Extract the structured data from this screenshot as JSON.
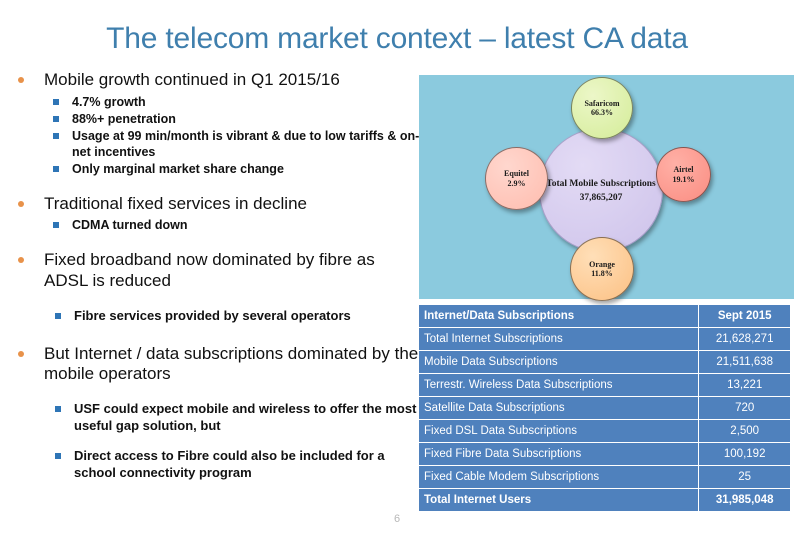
{
  "slide": {
    "title": "The telecom market context – latest CA data",
    "page_number": "6"
  },
  "colors": {
    "title": "#3f7fad",
    "bullet_level1": "#e8924a",
    "bullet_level2": "#2e75b6",
    "table_fill": "#4f81bd",
    "chart_background": "#8bcade"
  },
  "bullets": [
    {
      "text": "Mobile growth continued in Q1 2015/16",
      "sub": [
        "4.7% growth",
        "88%+ penetration",
        "Usage at 99 min/month is vibrant & due to low tariffs & on-net incentives",
        "Only marginal market share change"
      ]
    },
    {
      "text": "Traditional fixed services in decline",
      "sub": [
        "CDMA turned down"
      ]
    },
    {
      "text": "Fixed broadband now dominated by fibre as ADSL is reduced",
      "sub": [
        "Fibre services provided by several operators"
      ]
    },
    {
      "text": "But Internet / data subscriptions dominated by the mobile operators",
      "sub": [
        "USF could expect mobile and wireless to offer the most useful gap solution, but",
        "Direct access to Fibre could also be included for a school connectivity program"
      ]
    }
  ],
  "chart_data": {
    "type": "pie",
    "title": "Total Mobile Subscriptions",
    "center_label": "Total Mobile Subscriptions",
    "center_value": "37,865,207",
    "categories": [
      "Safaricom",
      "Airtel",
      "Orange",
      "Equitel"
    ],
    "values": [
      66.3,
      19.1,
      11.8,
      2.9
    ],
    "labels": [
      "66.3%",
      "19.1%",
      "11.8%",
      "2.9%"
    ],
    "units": "percent market share",
    "legend": "none",
    "grid": false
  },
  "table": {
    "columns": [
      "Internet/Data Subscriptions",
      "Sept 2015"
    ],
    "rows": [
      {
        "label": "Total Internet Subscriptions",
        "value": "21,628,271"
      },
      {
        "label": "Mobile Data Subscriptions",
        "value": "21,511,638"
      },
      {
        "label": "Terrestr. Wireless Data Subscriptions",
        "value": "13,221"
      },
      {
        "label": "Satellite Data Subscriptions",
        "value": "720"
      },
      {
        "label": "Fixed DSL Data Subscriptions",
        "value": "2,500"
      },
      {
        "label": "Fixed Fibre Data Subscriptions",
        "value": "100,192"
      },
      {
        "label": "Fixed Cable Modem Subscriptions",
        "value": "25"
      }
    ],
    "total": {
      "label": "Total Internet Users",
      "value": "31,985,048"
    }
  }
}
